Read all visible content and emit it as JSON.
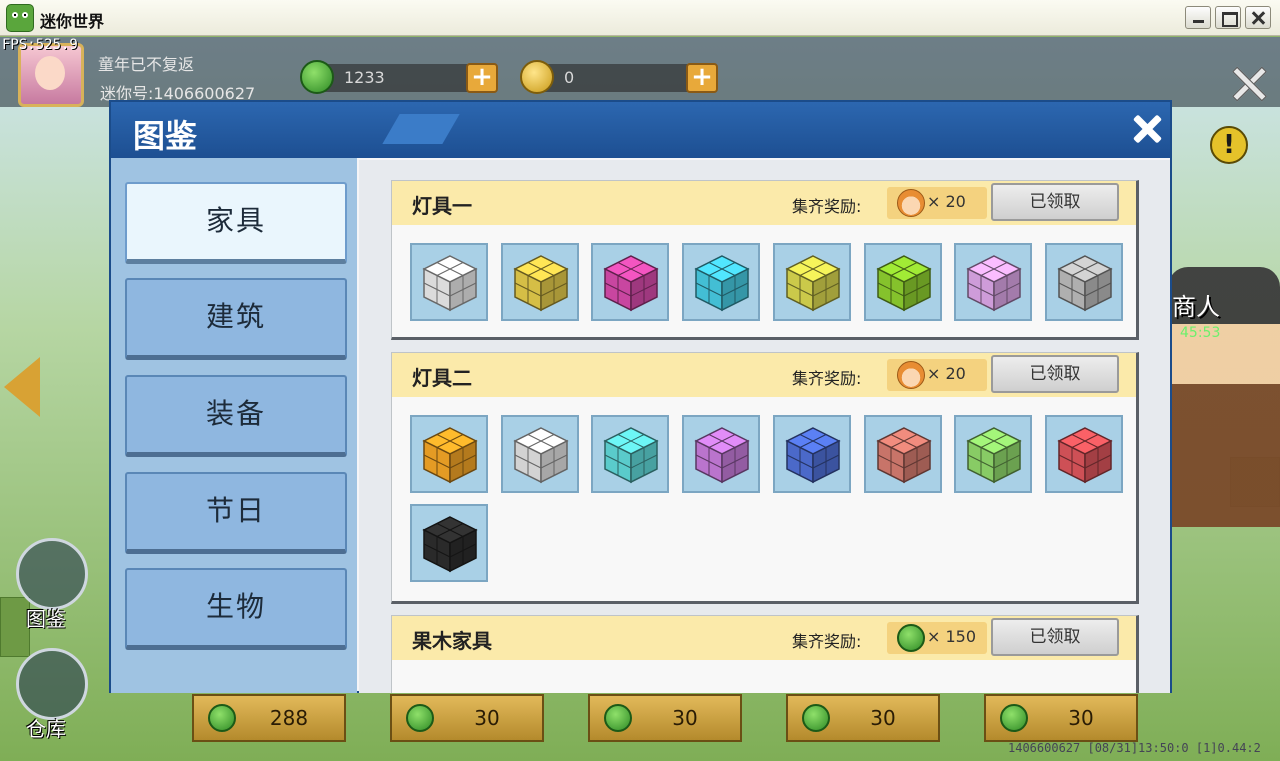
{
  "window": {
    "title": "迷你世界"
  },
  "hud": {
    "fps": "FPS:525.9",
    "player_name": "童年已不复返",
    "player_id": "迷你号:1406600627",
    "currency_green": "1233",
    "currency_gold": "0",
    "npc_label": "商人",
    "npc_time": "45:53",
    "side_buttons": [
      "图鉴",
      "仓库"
    ],
    "bottom_slots": [
      "288",
      "30",
      "30",
      "30",
      "30"
    ],
    "status_line": "1406600627 [08/31]13:50:0 [1]0.44:2"
  },
  "dialog": {
    "title": "图鉴",
    "categories": [
      "家具",
      "建筑",
      "装备",
      "节日",
      "生物"
    ],
    "active_category": "家具",
    "reward_label": "集齐奖励:",
    "sets": [
      {
        "title": "灯具一",
        "reward_icon": "face-icon",
        "reward_count": "× 20",
        "claim_label": "已领取",
        "items": [
          "#e6e6e6",
          "#e0c84a",
          "#d34aa8",
          "#46c8df",
          "#d6d44e",
          "#8ccc2e",
          "#d9a4e4",
          "#b8b8b8"
        ]
      },
      {
        "title": "灯具二",
        "reward_icon": "face-icon",
        "reward_count": "× 20",
        "claim_label": "已领取",
        "items": [
          "#f0a326",
          "#dedede",
          "#5fd6d6",
          "#c47ad8",
          "#4f6fd4",
          "#d27a6e",
          "#8fd66a",
          "#d9545a",
          "#2c2c2c"
        ]
      },
      {
        "title": "果木家具",
        "reward_icon": "gem-icon",
        "reward_count": "× 150",
        "claim_label": "已领取",
        "items": []
      }
    ]
  },
  "colors": {
    "header_blue": "#1d4f92",
    "set_header": "#fbeaaa",
    "tile_bg": "#a9d0e6"
  }
}
